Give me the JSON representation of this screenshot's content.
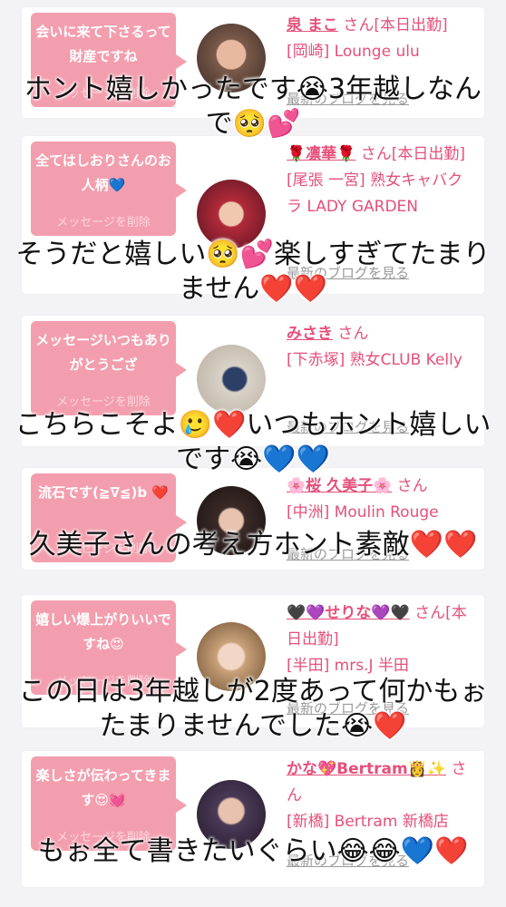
{
  "cards": [
    {
      "bubble": "会いに来て下さるって財産ですね",
      "delete": "メッセージを削除",
      "name": "泉 まこ",
      "san": "さん[本日出勤]",
      "shop": "[岡崎] Lounge ulu",
      "blog": "最新のブログを見る",
      "avatar_color": "#7b5a4a"
    },
    {
      "bubble": "全てはしおりさんのお人柄💙",
      "delete": "メッセージを削除",
      "name": "🌹凛華🌹",
      "san": "さん[本日出勤]",
      "shop": "[尾張 一宮] 熟女キャバクラ LADY GARDEN",
      "blog": "最新のブログを見る",
      "avatar_color": "#b22a3a"
    },
    {
      "bubble": "メッセージいつもありがとうござ",
      "delete": "メッセージを削除",
      "name": "みさき",
      "san": "さん",
      "shop": "[下赤塚] 熟女CLUB Kelly",
      "blog": "最新のブログを見る",
      "avatar_color": "#d8d2c8"
    },
    {
      "bubble": "流石です(≧∇≦)b ❤️",
      "delete": "メッセージを削除",
      "name": "🌸桜 久美子🌸",
      "san": "さん",
      "shop": "[中洲] Moulin Rouge",
      "blog": "最新のブログを見る",
      "avatar_color": "#3a2a28"
    },
    {
      "bubble": "嬉しい爆上がりいいですね😍",
      "delete": "メッセージを削除",
      "name": "🖤💜せりな💜🖤",
      "san": "さん[本日出勤]",
      "shop": "[半田] mrs.J 半田",
      "blog": "最新のブログを見る",
      "avatar_color": "#c9a27a"
    },
    {
      "bubble": "楽しさが伝わってきます😍💓",
      "delete": "メッセージを削除",
      "name": "かな💖Bertram👸✨",
      "san": "さん",
      "shop": "[新橋] Bertram 新橋店",
      "blog": "最新のブログを見る",
      "avatar_color": "#4a3a56"
    }
  ],
  "overlays": [
    "ホント嬉しかったです😭3年越しなんで🥺💕",
    "そうだと嬉しい🥺💕楽しすぎてたまりません❤️❤️",
    "こちらこそよ🥲❤️いつもホント嬉しいです😭💙💙",
    "久美子さんの考え方ホント素敵❤️❤️",
    "この日は3年越しが2度あって何かもぉたまりませんでした😭❤️",
    "もぉ全て書きたいぐらい😂😂💙❤️"
  ]
}
